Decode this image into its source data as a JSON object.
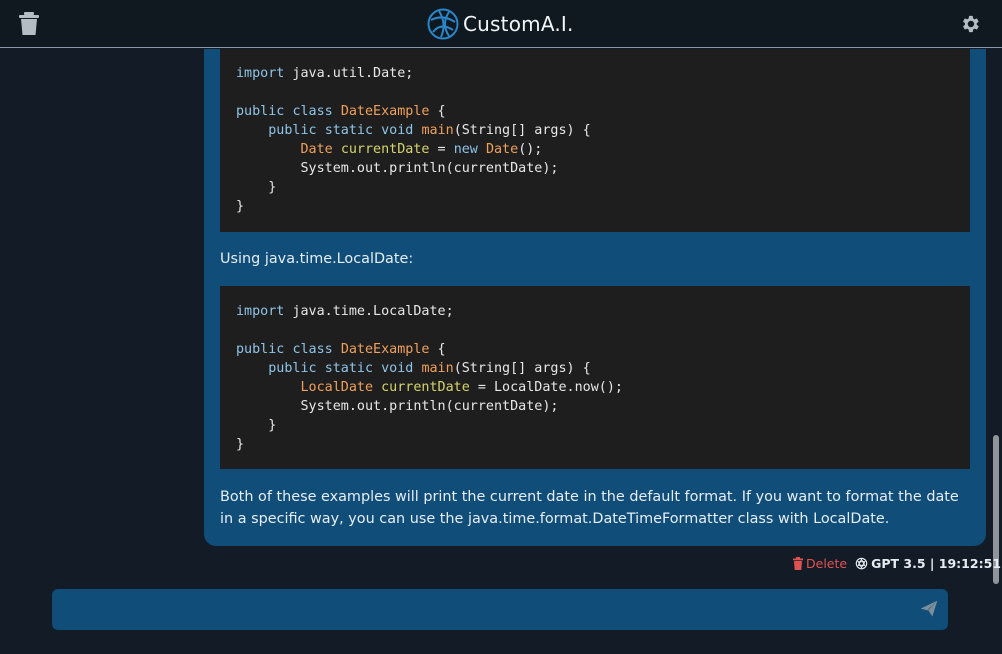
{
  "header": {
    "app_title": "CustomA.I.",
    "icons": {
      "left": "trash-icon",
      "right": "gear-icon",
      "logo": "brand-logo-icon"
    }
  },
  "message": {
    "code_blocks": [
      {
        "lines": [
          "import java.util.Date;",
          "",
          "public class DateExample {",
          "    public static void main(String[] args) {",
          "        Date currentDate = new Date();",
          "        System.out.println(currentDate);",
          "    }",
          "}"
        ]
      },
      {
        "lines": [
          "import java.time.LocalDate;",
          "",
          "public class DateExample {",
          "    public static void main(String[] args) {",
          "        LocalDate currentDate = LocalDate.now();",
          "        System.out.println(currentDate);",
          "    }",
          "}"
        ]
      }
    ],
    "paragraph_between": "Using java.time.LocalDate:",
    "paragraph_final": "Both of these examples will print the current date in the default format. If you want to format the date in a specific way, you can use the java.time.format.DateTimeFormatter class with LocalDate."
  },
  "meta": {
    "delete_label": "Delete",
    "model_label": "GPT 3.5 | 19:12:51"
  },
  "composer": {
    "value": "",
    "placeholder": ""
  },
  "colors": {
    "background": "#131c26",
    "bubble": "#104d78",
    "code_bg": "#1e1e1e",
    "delete": "#e05252"
  }
}
